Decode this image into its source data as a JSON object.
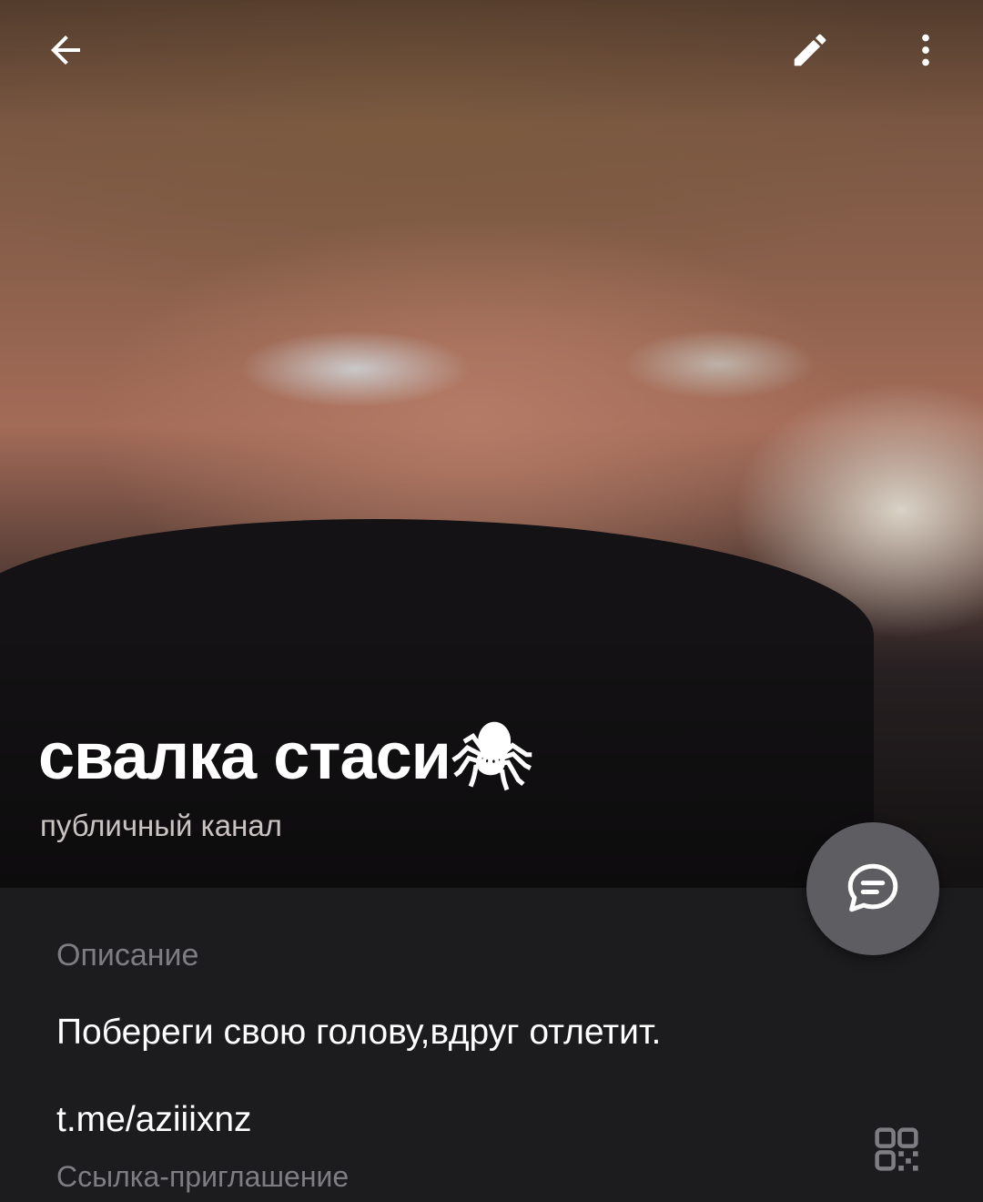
{
  "header": {
    "photo_alt": "channel avatar photo",
    "back_icon": "arrow-left-icon",
    "edit_icon": "pencil-icon",
    "more_icon": "more-vertical-icon"
  },
  "channel": {
    "title": "свалка стаси🕷",
    "subtitle": "публичный канал"
  },
  "fab": {
    "icon": "message-bubble-icon"
  },
  "info": {
    "description_label": "Описание",
    "description_text": "Побереги свою голову,вдруг отлетит.",
    "link_text": "t.me/aziiixnz",
    "link_label": "Ссылка-приглашение",
    "qr_icon": "qr-code-icon"
  },
  "colors": {
    "background": "#1c1c1e",
    "secondary_text": "#7e7d82",
    "fab": "#5e5d62"
  }
}
